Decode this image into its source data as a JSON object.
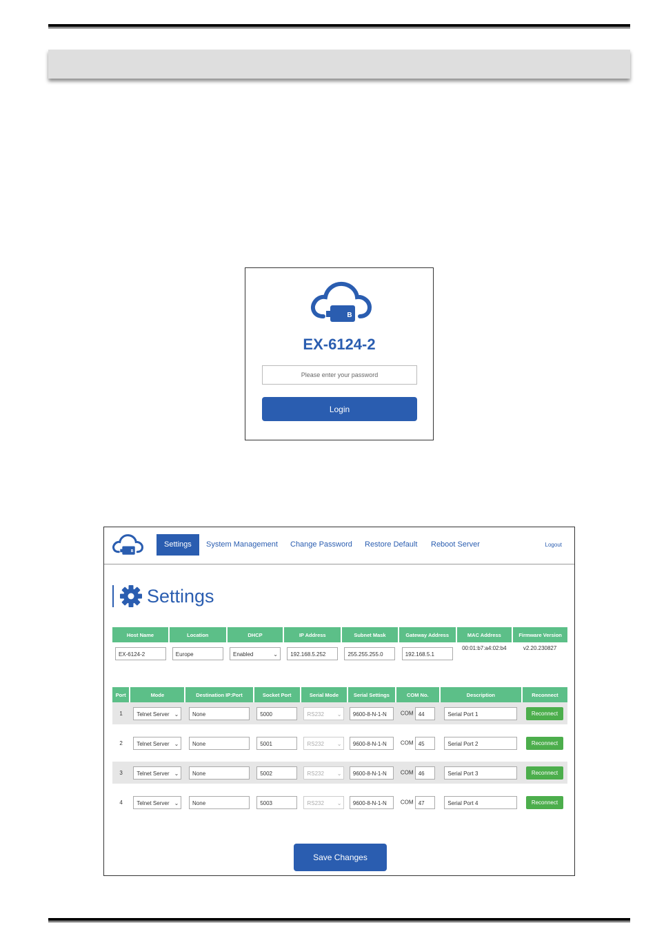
{
  "login": {
    "title": "EX-6124-2",
    "password_placeholder": "Please enter your password",
    "login_label": "Login"
  },
  "nav": {
    "items": [
      "Settings",
      "System Management",
      "Change Password",
      "Restore Default",
      "Reboot Server"
    ],
    "active": "Settings",
    "logout": "Logout"
  },
  "settings": {
    "title": "Settings",
    "info_headers": [
      "Host Name",
      "Location",
      "DHCP",
      "IP Address",
      "Subnet Mask",
      "Gateway Address",
      "MAC Address",
      "Firmware Version"
    ],
    "info": {
      "host_name": "EX-6124-2",
      "location": "Europe",
      "dhcp": "Enabled",
      "ip_address": "192.168.5.252",
      "subnet_mask": "255.255.255.0",
      "gateway": "192.168.5.1",
      "mac": "00:01:b7:a4:02:b4",
      "firmware": "v2.20.230827"
    },
    "port_headers": [
      "Port",
      "Mode",
      "Destination IP:Port",
      "Socket Port",
      "Serial Mode",
      "Serial Settings",
      "COM No.",
      "Description",
      "Reconnect"
    ],
    "com_label": "COM",
    "reconnect_label": "Reconnect",
    "ports": [
      {
        "port": "1",
        "mode": "Telnet Server",
        "dest": "None",
        "socket": "5000",
        "serial_mode": "RS232",
        "serial_settings": "9600-8-N-1-N",
        "com": "44",
        "description": "Serial Port 1"
      },
      {
        "port": "2",
        "mode": "Telnet Server",
        "dest": "None",
        "socket": "5001",
        "serial_mode": "RS232",
        "serial_settings": "9600-8-N-1-N",
        "com": "45",
        "description": "Serial Port 2"
      },
      {
        "port": "3",
        "mode": "Telnet Server",
        "dest": "None",
        "socket": "5002",
        "serial_mode": "RS232",
        "serial_settings": "9600-8-N-1-N",
        "com": "46",
        "description": "Serial Port 3"
      },
      {
        "port": "4",
        "mode": "Telnet Server",
        "dest": "None",
        "socket": "5003",
        "serial_mode": "RS232",
        "serial_settings": "9600-8-N-1-N",
        "com": "47",
        "description": "Serial Port 4"
      }
    ],
    "save_label": "Save Changes"
  },
  "colors": {
    "brand_blue": "#2a5db0",
    "header_green": "#5cbf88",
    "button_green": "#4cae4c"
  },
  "icons": [
    "cloud-usb-logo-icon",
    "gear-icon",
    "chevron-down-icon"
  ]
}
